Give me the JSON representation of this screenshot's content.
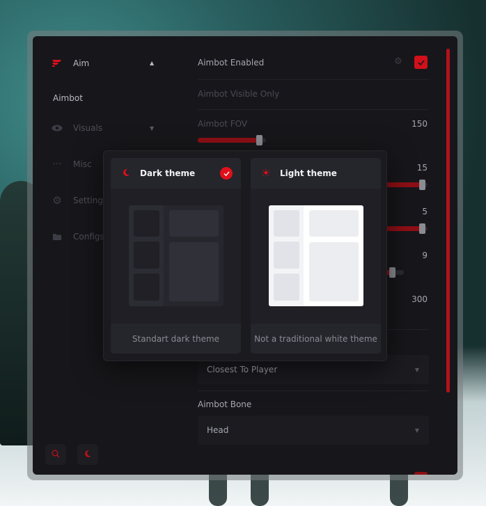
{
  "sidebar": {
    "sections": [
      {
        "label": "Aim",
        "icon": "logo-icon",
        "expanded": true
      },
      {
        "label": "Visuals",
        "icon": "eye-icon",
        "expanded": false
      },
      {
        "label": "Misc",
        "icon": "dots-icon"
      },
      {
        "label": "Settings",
        "icon": "gear-icon"
      },
      {
        "label": "Configs",
        "icon": "folder-icon"
      }
    ],
    "sub_item": "Aimbot",
    "bottom_buttons": [
      {
        "icon": "search-icon"
      },
      {
        "icon": "moon-icon"
      }
    ]
  },
  "settings": {
    "aimbot_enabled": {
      "label": "Aimbot Enabled",
      "checked": true
    },
    "aimbot_visible_only": {
      "label": "Aimbot Visible Only"
    },
    "aimbot_fov": {
      "label": "Aimbot FOV",
      "value": "150",
      "fill": 0.95
    },
    "slider2": {
      "value": "15",
      "fill": 0.99
    },
    "slider3": {
      "value": "5",
      "fill": 0.99
    },
    "slider4": {
      "value": "9",
      "fill": 0.96
    },
    "slider5": {
      "value": "300"
    },
    "target_select": {
      "value": "Closest To Player"
    },
    "aimbot_bone": {
      "label": "Aimbot Bone",
      "value": "Head"
    }
  },
  "theme_popup": {
    "dark": {
      "title": "Dark theme",
      "caption": "Standart dark theme",
      "selected": true
    },
    "light": {
      "title": "Light theme",
      "caption": "Not a traditional white theme",
      "selected": false
    }
  },
  "colors": {
    "accent": "#e0101a",
    "panel": "#17171b",
    "text": "#a6a6b0"
  }
}
